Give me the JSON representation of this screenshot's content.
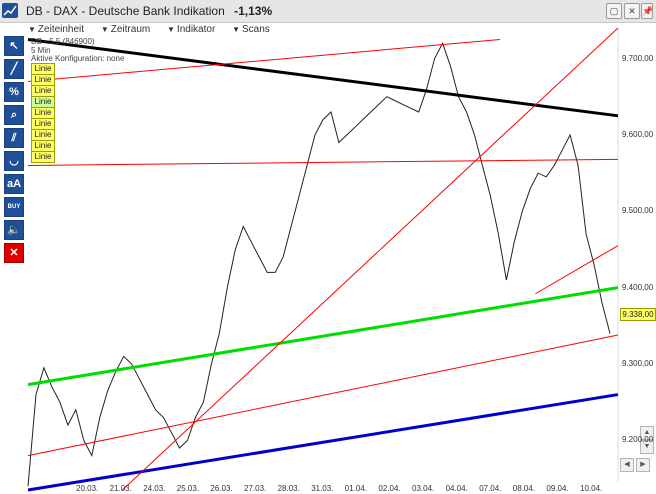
{
  "window": {
    "title": "DB - DAX - Deutsche Bank Indikation",
    "change": "-1,13%",
    "btn_restore": "▢",
    "btn_close": "✕",
    "btn_pin": "📌"
  },
  "menu": [
    {
      "label": "Zeiteinheit"
    },
    {
      "label": "Zeitraum"
    },
    {
      "label": "Indikator"
    },
    {
      "label": "Scans"
    }
  ],
  "chart_info": {
    "symbol": "DB - 5.5 (846900)",
    "interval": "5 Min",
    "config": "Aktive Konfiguration: none"
  },
  "tools": [
    {
      "name": "select-tool",
      "glyph": "↖"
    },
    {
      "name": "line-tool",
      "glyph": "╱"
    },
    {
      "name": "percent-tool",
      "glyph": "%"
    },
    {
      "name": "zoom-tool",
      "glyph": "⌕"
    },
    {
      "name": "channel-tool",
      "glyph": "⫽"
    },
    {
      "name": "arc-tool",
      "glyph": "◡"
    },
    {
      "name": "text-tool",
      "glyph": "aA"
    },
    {
      "name": "buy-sell-tool",
      "glyph": "BUY"
    },
    {
      "name": "sound-tool",
      "glyph": "🔈"
    },
    {
      "name": "delete-tool",
      "glyph": "✕"
    }
  ],
  "legend": [
    {
      "label": "Linie",
      "color": "#000000"
    },
    {
      "label": "Linie",
      "color": "#ff0000"
    },
    {
      "label": "Linie",
      "color": "#ff0000"
    },
    {
      "label": "Linie",
      "color": "#00cc00"
    },
    {
      "label": "Linie",
      "color": "#ff0000"
    },
    {
      "label": "Linie",
      "color": "#ff0000"
    },
    {
      "label": "Linie",
      "color": "#ff0000"
    },
    {
      "label": "Linie",
      "color": "#ff0000"
    },
    {
      "label": "Linie",
      "color": "#ff0000"
    }
  ],
  "current_price": "9.338,00",
  "chart_data": {
    "type": "line",
    "yaxis_ticks": [
      "9.700,00",
      "9.600,00",
      "9.500,00",
      "9.400,00",
      "9.300,00",
      "9.200,00"
    ],
    "xaxis_ticks": [
      "20.03.",
      "21.03.",
      "24.03.",
      "25.03.",
      "26.03.",
      "27.03.",
      "28.03.",
      "31.03.",
      "01.04.",
      "02.04.",
      "03.04.",
      "04.04.",
      "07.04.",
      "08.04.",
      "09.04.",
      "10.04."
    ],
    "ylim": [
      9135,
      9740
    ],
    "series": [
      {
        "values": [
          9140,
          9260,
          9295,
          9270,
          9250,
          9220,
          9240,
          9200,
          9180,
          9230,
          9265,
          9290,
          9310,
          9300,
          9280,
          9260,
          9240,
          9230,
          9210,
          9190,
          9200,
          9230,
          9250,
          9300,
          9340,
          9400,
          9450,
          9480,
          9460,
          9440,
          9420,
          9420,
          9440,
          9480,
          9520,
          9560,
          9600,
          9620,
          9630,
          9590,
          9600,
          9610,
          9620,
          9630,
          9640,
          9650,
          9645,
          9640,
          9635,
          9630,
          9660,
          9700,
          9720,
          9690,
          9650,
          9630,
          9600,
          9560,
          9520,
          9470,
          9410,
          9460,
          9500,
          9530,
          9550,
          9545,
          9560,
          9580,
          9600,
          9560,
          9470,
          9430,
          9380,
          9340
        ]
      }
    ],
    "trendlines": [
      {
        "color": "#000000",
        "from": [
          0,
          9725
        ],
        "to": [
          1,
          9625
        ]
      },
      {
        "color": "#ff0000",
        "from": [
          0,
          9670
        ],
        "to": [
          0.8,
          9725
        ]
      },
      {
        "color": "#ff0000",
        "from": [
          0,
          9560
        ],
        "to": [
          1,
          9568
        ]
      },
      {
        "color": "#00dd00",
        "from": [
          0,
          9273
        ],
        "to": [
          1,
          9400
        ]
      },
      {
        "color": "#ff0000",
        "from": [
          0,
          9180
        ],
        "to": [
          1,
          9338
        ]
      },
      {
        "color": "#0000cc",
        "from": [
          0,
          9135
        ],
        "to": [
          1,
          9260
        ]
      },
      {
        "color": "#ff0000",
        "from": [
          0.16,
          9135
        ],
        "to": [
          1,
          9740
        ]
      },
      {
        "color": "#ff0000",
        "from": [
          0.86,
          9392
        ],
        "to": [
          1,
          9455
        ]
      }
    ],
    "grid": false
  }
}
